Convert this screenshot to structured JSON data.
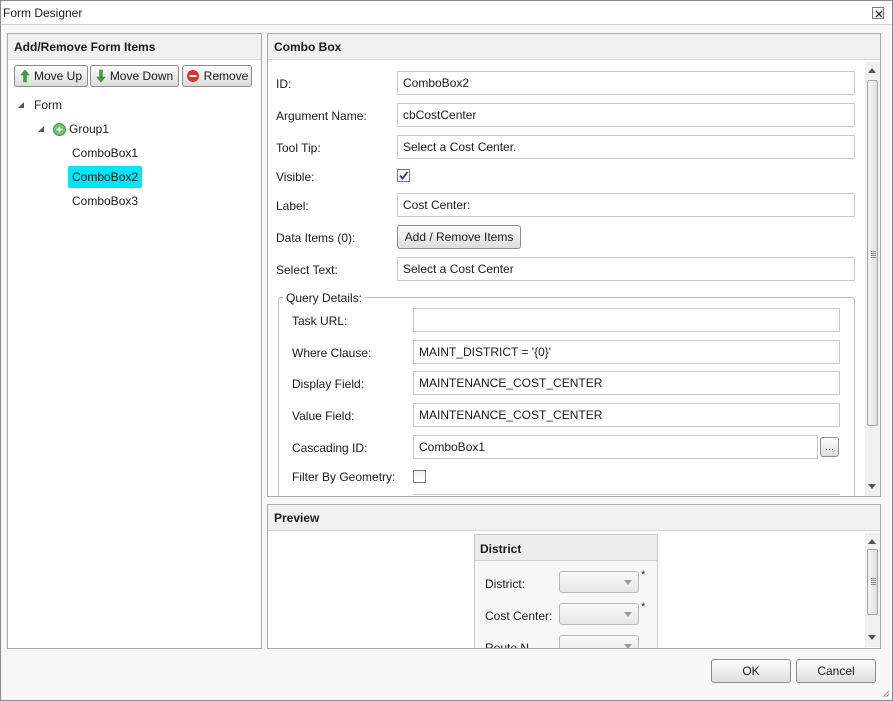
{
  "window": {
    "title": "Form Designer"
  },
  "left_panel": {
    "header": "Add/Remove Form Items",
    "buttons": {
      "move_up": "Move Up",
      "move_down": "Move Down",
      "remove": "Remove"
    },
    "tree": {
      "root": "Form",
      "group": "Group1",
      "items": [
        "ComboBox1",
        "ComboBox2",
        "ComboBox3"
      ],
      "selected": "ComboBox2"
    }
  },
  "props_panel": {
    "header": "Combo Box",
    "fields": {
      "id": {
        "label": "ID:",
        "value": "ComboBox2"
      },
      "argument_name": {
        "label": "Argument Name:",
        "value": "cbCostCenter"
      },
      "tool_tip": {
        "label": "Tool Tip:",
        "value": "Select a Cost Center."
      },
      "visible": {
        "label": "Visible:",
        "checked": true
      },
      "label": {
        "label": "Label:",
        "value": "Cost Center:"
      },
      "data_items": {
        "label": "Data Items (0):",
        "button": "Add / Remove Items"
      },
      "select_text": {
        "label": "Select Text:",
        "value": "Select a Cost Center"
      }
    },
    "query_details": {
      "legend": "Query Details:",
      "task_url": {
        "label": "Task URL:",
        "value": ""
      },
      "where_clause": {
        "label": "Where Clause:",
        "value": "MAINT_DISTRICT = '{0}'"
      },
      "display_field": {
        "label": "Display Field:",
        "value": "MAINTENANCE_COST_CENTER"
      },
      "value_field": {
        "label": "Value Field:",
        "value": "MAINTENANCE_COST_CENTER"
      },
      "cascading_id": {
        "label": "Cascading ID:",
        "value": "ComboBox1",
        "browse": "..."
      },
      "filter_by_geometry": {
        "label": "Filter By Geometry:",
        "checked": false
      }
    }
  },
  "preview_panel": {
    "header": "Preview",
    "card": {
      "title": "District",
      "rows": [
        {
          "label": "District:",
          "required": "*"
        },
        {
          "label": "Cost Center:",
          "required": "*"
        },
        {
          "label": "Route N",
          "required": ""
        }
      ]
    }
  },
  "footer": {
    "ok": "OK",
    "cancel": "Cancel"
  },
  "colors": {
    "selection": "#00e5f5",
    "accent_green": "#3aa53a",
    "remove_red": "#d9312b"
  },
  "icons": [
    "close-icon",
    "arrow-up-icon",
    "arrow-down-icon",
    "remove-icon",
    "expand-triangle-icon",
    "group-add-icon",
    "checkmark-icon",
    "dropdown-caret-icon"
  ]
}
